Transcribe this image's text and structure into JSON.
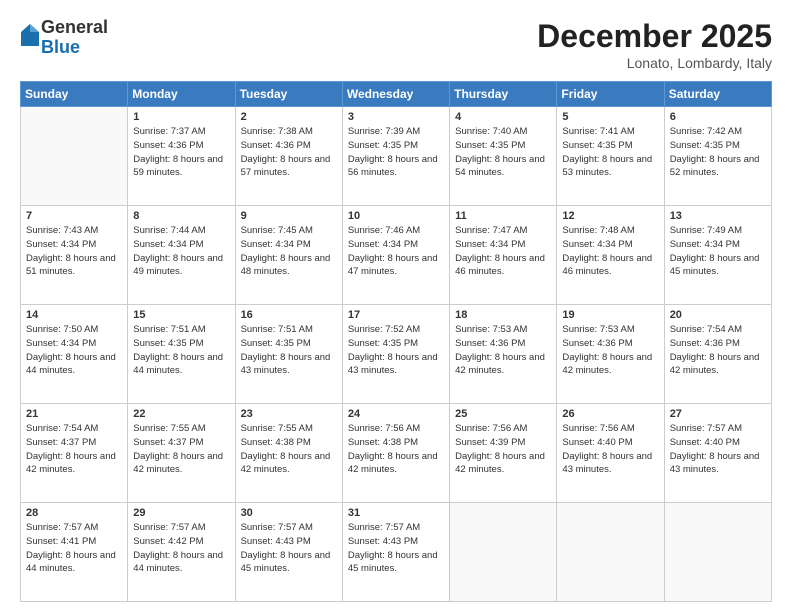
{
  "header": {
    "logo": {
      "general": "General",
      "blue": "Blue"
    },
    "title": "December 2025",
    "location": "Lonato, Lombardy, Italy"
  },
  "calendar": {
    "days_of_week": [
      "Sunday",
      "Monday",
      "Tuesday",
      "Wednesday",
      "Thursday",
      "Friday",
      "Saturday"
    ],
    "weeks": [
      [
        {
          "day": "",
          "empty": true
        },
        {
          "day": "1",
          "sunrise": "Sunrise: 7:37 AM",
          "sunset": "Sunset: 4:36 PM",
          "daylight": "Daylight: 8 hours and 59 minutes."
        },
        {
          "day": "2",
          "sunrise": "Sunrise: 7:38 AM",
          "sunset": "Sunset: 4:36 PM",
          "daylight": "Daylight: 8 hours and 57 minutes."
        },
        {
          "day": "3",
          "sunrise": "Sunrise: 7:39 AM",
          "sunset": "Sunset: 4:35 PM",
          "daylight": "Daylight: 8 hours and 56 minutes."
        },
        {
          "day": "4",
          "sunrise": "Sunrise: 7:40 AM",
          "sunset": "Sunset: 4:35 PM",
          "daylight": "Daylight: 8 hours and 54 minutes."
        },
        {
          "day": "5",
          "sunrise": "Sunrise: 7:41 AM",
          "sunset": "Sunset: 4:35 PM",
          "daylight": "Daylight: 8 hours and 53 minutes."
        },
        {
          "day": "6",
          "sunrise": "Sunrise: 7:42 AM",
          "sunset": "Sunset: 4:35 PM",
          "daylight": "Daylight: 8 hours and 52 minutes."
        }
      ],
      [
        {
          "day": "7",
          "sunrise": "Sunrise: 7:43 AM",
          "sunset": "Sunset: 4:34 PM",
          "daylight": "Daylight: 8 hours and 51 minutes."
        },
        {
          "day": "8",
          "sunrise": "Sunrise: 7:44 AM",
          "sunset": "Sunset: 4:34 PM",
          "daylight": "Daylight: 8 hours and 49 minutes."
        },
        {
          "day": "9",
          "sunrise": "Sunrise: 7:45 AM",
          "sunset": "Sunset: 4:34 PM",
          "daylight": "Daylight: 8 hours and 48 minutes."
        },
        {
          "day": "10",
          "sunrise": "Sunrise: 7:46 AM",
          "sunset": "Sunset: 4:34 PM",
          "daylight": "Daylight: 8 hours and 47 minutes."
        },
        {
          "day": "11",
          "sunrise": "Sunrise: 7:47 AM",
          "sunset": "Sunset: 4:34 PM",
          "daylight": "Daylight: 8 hours and 46 minutes."
        },
        {
          "day": "12",
          "sunrise": "Sunrise: 7:48 AM",
          "sunset": "Sunset: 4:34 PM",
          "daylight": "Daylight: 8 hours and 46 minutes."
        },
        {
          "day": "13",
          "sunrise": "Sunrise: 7:49 AM",
          "sunset": "Sunset: 4:34 PM",
          "daylight": "Daylight: 8 hours and 45 minutes."
        }
      ],
      [
        {
          "day": "14",
          "sunrise": "Sunrise: 7:50 AM",
          "sunset": "Sunset: 4:34 PM",
          "daylight": "Daylight: 8 hours and 44 minutes."
        },
        {
          "day": "15",
          "sunrise": "Sunrise: 7:51 AM",
          "sunset": "Sunset: 4:35 PM",
          "daylight": "Daylight: 8 hours and 44 minutes."
        },
        {
          "day": "16",
          "sunrise": "Sunrise: 7:51 AM",
          "sunset": "Sunset: 4:35 PM",
          "daylight": "Daylight: 8 hours and 43 minutes."
        },
        {
          "day": "17",
          "sunrise": "Sunrise: 7:52 AM",
          "sunset": "Sunset: 4:35 PM",
          "daylight": "Daylight: 8 hours and 43 minutes."
        },
        {
          "day": "18",
          "sunrise": "Sunrise: 7:53 AM",
          "sunset": "Sunset: 4:36 PM",
          "daylight": "Daylight: 8 hours and 42 minutes."
        },
        {
          "day": "19",
          "sunrise": "Sunrise: 7:53 AM",
          "sunset": "Sunset: 4:36 PM",
          "daylight": "Daylight: 8 hours and 42 minutes."
        },
        {
          "day": "20",
          "sunrise": "Sunrise: 7:54 AM",
          "sunset": "Sunset: 4:36 PM",
          "daylight": "Daylight: 8 hours and 42 minutes."
        }
      ],
      [
        {
          "day": "21",
          "sunrise": "Sunrise: 7:54 AM",
          "sunset": "Sunset: 4:37 PM",
          "daylight": "Daylight: 8 hours and 42 minutes."
        },
        {
          "day": "22",
          "sunrise": "Sunrise: 7:55 AM",
          "sunset": "Sunset: 4:37 PM",
          "daylight": "Daylight: 8 hours and 42 minutes."
        },
        {
          "day": "23",
          "sunrise": "Sunrise: 7:55 AM",
          "sunset": "Sunset: 4:38 PM",
          "daylight": "Daylight: 8 hours and 42 minutes."
        },
        {
          "day": "24",
          "sunrise": "Sunrise: 7:56 AM",
          "sunset": "Sunset: 4:38 PM",
          "daylight": "Daylight: 8 hours and 42 minutes."
        },
        {
          "day": "25",
          "sunrise": "Sunrise: 7:56 AM",
          "sunset": "Sunset: 4:39 PM",
          "daylight": "Daylight: 8 hours and 42 minutes."
        },
        {
          "day": "26",
          "sunrise": "Sunrise: 7:56 AM",
          "sunset": "Sunset: 4:40 PM",
          "daylight": "Daylight: 8 hours and 43 minutes."
        },
        {
          "day": "27",
          "sunrise": "Sunrise: 7:57 AM",
          "sunset": "Sunset: 4:40 PM",
          "daylight": "Daylight: 8 hours and 43 minutes."
        }
      ],
      [
        {
          "day": "28",
          "sunrise": "Sunrise: 7:57 AM",
          "sunset": "Sunset: 4:41 PM",
          "daylight": "Daylight: 8 hours and 44 minutes."
        },
        {
          "day": "29",
          "sunrise": "Sunrise: 7:57 AM",
          "sunset": "Sunset: 4:42 PM",
          "daylight": "Daylight: 8 hours and 44 minutes."
        },
        {
          "day": "30",
          "sunrise": "Sunrise: 7:57 AM",
          "sunset": "Sunset: 4:43 PM",
          "daylight": "Daylight: 8 hours and 45 minutes."
        },
        {
          "day": "31",
          "sunrise": "Sunrise: 7:57 AM",
          "sunset": "Sunset: 4:43 PM",
          "daylight": "Daylight: 8 hours and 45 minutes."
        },
        {
          "day": "",
          "empty": true
        },
        {
          "day": "",
          "empty": true
        },
        {
          "day": "",
          "empty": true
        }
      ]
    ]
  }
}
